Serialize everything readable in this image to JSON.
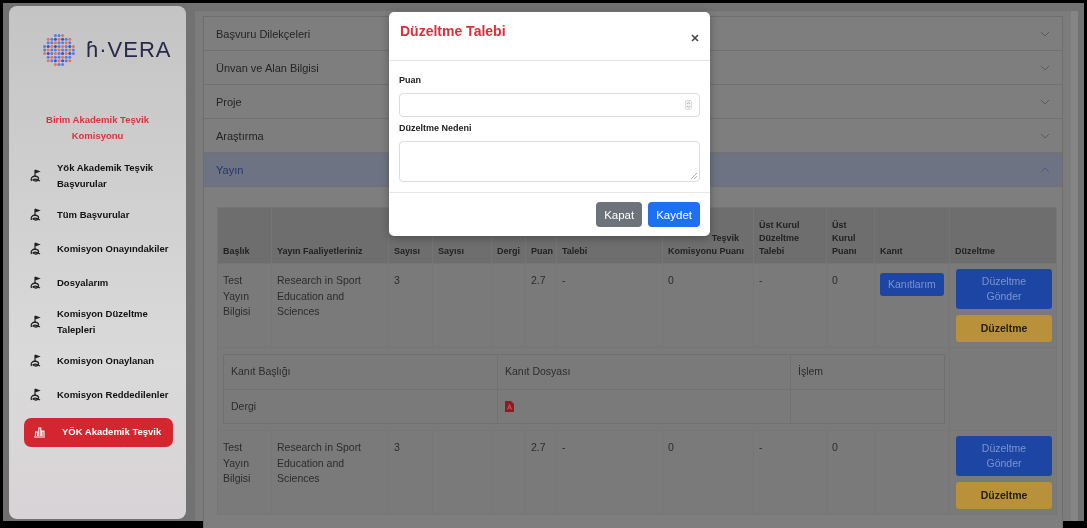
{
  "sidebar": {
    "logo_text": "ɦ·VERA",
    "role": "Birim Akademik Teşvik Komisyonu",
    "items": [
      {
        "label": "Yök Akademik Teşvik Başvurular",
        "kind": "flag",
        "selected": false
      },
      {
        "label": "Tüm Başvurular",
        "kind": "flag",
        "selected": false
      },
      {
        "label": "Komisyon Onayındakiler",
        "kind": "flag",
        "selected": false
      },
      {
        "label": "Dosyalarım",
        "kind": "flag",
        "selected": false
      },
      {
        "label": "Komisyon Düzeltme Talepleri",
        "kind": "flag",
        "selected": false
      },
      {
        "label": "Komisyon Onaylanan",
        "kind": "flag",
        "selected": false
      },
      {
        "label": "Komisyon Reddedilenler",
        "kind": "flag",
        "selected": false
      },
      {
        "label": "YÖK Akademik Teşvik",
        "kind": "chart",
        "selected": true
      }
    ]
  },
  "accordion": [
    {
      "title": "Başvuru Dilekçeleri",
      "expanded": false
    },
    {
      "title": "Ünvan ve Alan Bilgisi",
      "expanded": false
    },
    {
      "title": "Proje",
      "expanded": false
    },
    {
      "title": "Araştırma",
      "expanded": false
    },
    {
      "title": "Yayın",
      "expanded": true
    }
  ],
  "table": {
    "columns": [
      {
        "lines": [
          "Başlık"
        ]
      },
      {
        "lines": [
          "Yayın Faaliyetleriniz"
        ]
      },
      {
        "lines": [
          "Sayısı"
        ]
      },
      {
        "lines": [
          "Sayısı"
        ]
      },
      {
        "lines": [
          "Dergi"
        ]
      },
      {
        "lines": [
          "Puan"
        ]
      },
      {
        "lines": [
          "Talebi"
        ]
      },
      {
        "lines": [
          "Teşvik",
          "Komisyonu Puanı"
        ]
      },
      {
        "lines": [
          "Üst Kurul",
          "Düzeltme",
          "Talebi"
        ]
      },
      {
        "lines": [
          "Üst",
          "Kurul",
          "Puanı"
        ]
      },
      {
        "lines": [
          "Kanıt"
        ]
      },
      {
        "lines": [
          "Düzeltme"
        ]
      }
    ],
    "rows": [
      {
        "title": "Test Yayın Bilgisi",
        "activity": "Research in Sport Education and Sciences",
        "count": "3",
        "score": "2.7",
        "request": "-",
        "commission_score": "0",
        "board_request": "-",
        "board_score": "0",
        "evidence_button": "Kanıtlarım",
        "actions": [
          "Düzeltme Gönder",
          "Düzeltme"
        ],
        "evidence": {
          "columns": [
            "Kanıt Başlığı",
            "Kanıt Dosyası",
            "İşlem"
          ],
          "rows": [
            {
              "title": "Dergi"
            }
          ]
        }
      },
      {
        "title": "Test Yayın Bilgisi",
        "activity": "Research in Sport Education and Sciences",
        "count": "3",
        "score": "2.7",
        "request": "-",
        "commission_score": "0",
        "board_request": "-",
        "board_score": "0",
        "actions": [
          "Düzeltme Gönder",
          "Düzeltme"
        ]
      }
    ]
  },
  "modal": {
    "title": "Düzeltme Talebi",
    "fields": [
      {
        "label": "Puan",
        "kind": "number"
      },
      {
        "label": "Düzeltme Nedeni",
        "kind": "textarea"
      }
    ],
    "buttons": [
      {
        "label": "Kapat",
        "kind": "secondary"
      },
      {
        "label": "Kaydet",
        "kind": "primary"
      }
    ]
  }
}
